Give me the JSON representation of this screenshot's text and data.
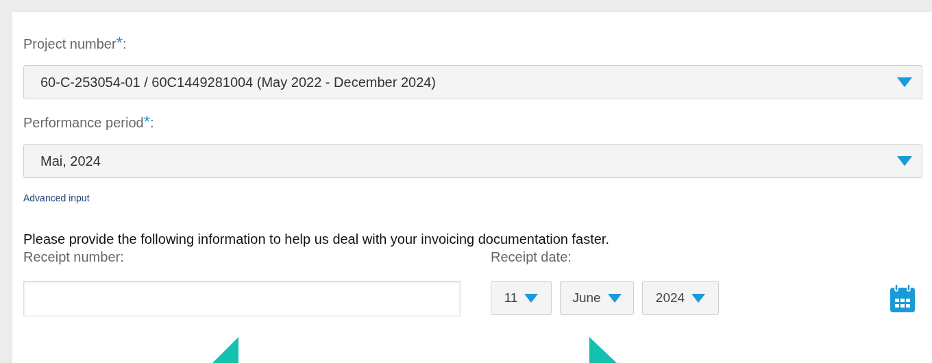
{
  "fields": [
    {
      "label": "Project number",
      "mark": "*",
      "suffix": ":",
      "value": "60-C-253054-01 / 60C1449281004 (May 2022 - December 2024)"
    },
    {
      "label": "Performance period",
      "mark": "*",
      "suffix": ":",
      "value": "Mai, 2024"
    }
  ],
  "advanced_link": "Advanced input",
  "info_text": "Please provide the following information to help us deal with your invoicing documentation faster.",
  "receipt_number": {
    "label": "Receipt number:"
  },
  "receipt_date": {
    "label": "Receipt date:",
    "parts": [
      {
        "kind": "day",
        "value": "11"
      },
      {
        "kind": "month",
        "value": "June"
      },
      {
        "kind": "year",
        "value": "2024"
      }
    ]
  }
}
